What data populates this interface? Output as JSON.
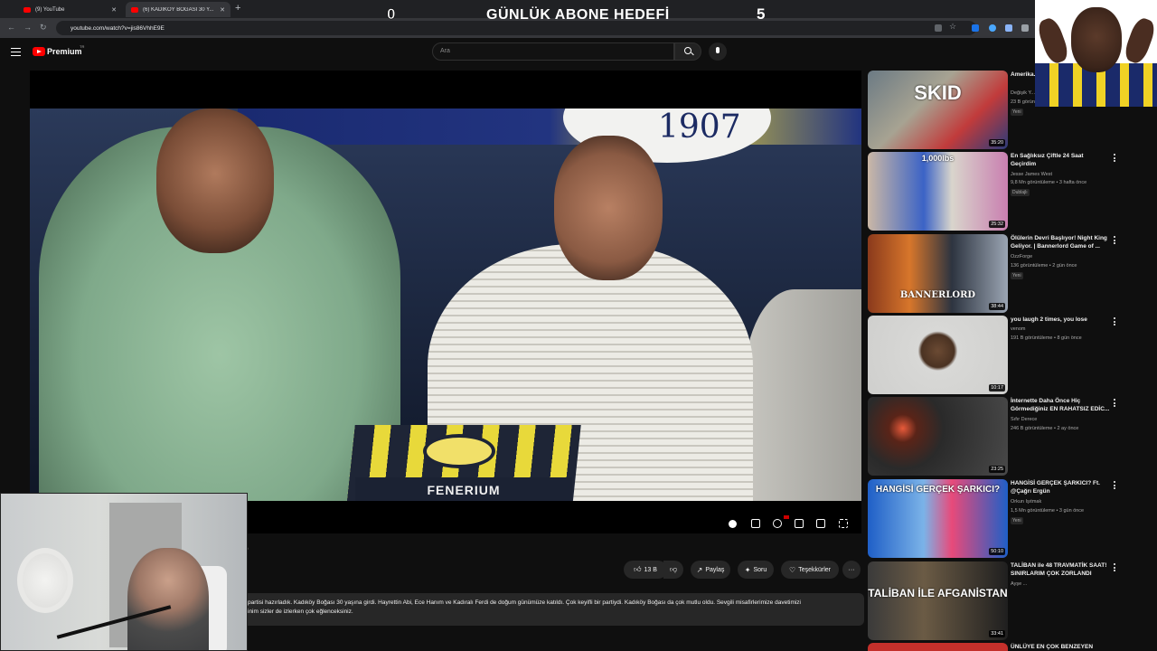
{
  "browser": {
    "tabs": [
      {
        "label": "(9) YouTube"
      },
      {
        "label": "(6) KADIKÖY BOĞASI 30 Y..."
      }
    ],
    "url": "youtube.com/watch?v=jis86VhhE9E"
  },
  "overlay": {
    "left_count": "0",
    "title": "GÜNLÜK ABONE HEDEFİ",
    "right_count": "5"
  },
  "youtube": {
    "brand": "Premium",
    "brand_sup": "TR",
    "search_placeholder": "Ara"
  },
  "player": {
    "scene_text_club": "1907",
    "scene_text_box": "FENERIUM"
  },
  "actions": {
    "likes": "13 B",
    "share": "Paylaş",
    "ask": "Soru",
    "thanks": "Teşekkürler"
  },
  "description": {
    "line1": "partisi hazırladık. Kadıköy Boğası 30 yaşına girdi. Hayrettin Abi, Ece Hanım ve Kadıralı Ferdi de doğum günümüze katıldı. Çok keyifli bir partiydi. Kadıköy Boğası da çok mutlu oldu. Sevgili misafirlerimize davetimizi",
    "line2": "inim sizler de izlerken çok eğlenceksiniz."
  },
  "recommendations": [
    {
      "title": "Amerika... Mahalle...",
      "channel": "Değişik Y...",
      "meta": "23 B görüntülenme",
      "badge": "Yeni",
      "duration": "35:20",
      "thumb_text": "SKID"
    },
    {
      "title": "En Sağlıksız Çiftle 24 Saat Geçirdim",
      "channel": "Jesse James West",
      "meta": "9,8 Mn görüntüleme • 3 hafta önce",
      "badge": "Dublajlı",
      "duration": "25:32",
      "thumb_text": "1,000lbs"
    },
    {
      "title": "Ölülerin Devri Başlıyor! Night King Geliyor. | Bannerlord Game of ...",
      "channel": "OzzForge",
      "meta": "136 görüntüleme • 2 gün önce",
      "badge": "Yeni",
      "duration": "38:44",
      "thumb_text": "BANNERLORD"
    },
    {
      "title": "you laugh 2 times, you lose",
      "channel": "venom",
      "meta": "191 B görüntüleme • 8 gün önce",
      "badge": "",
      "duration": "10:17",
      "thumb_text": ""
    },
    {
      "title": "İnternette Daha Önce Hiç Görmediğiniz EN RAHATSIZ EDİC...",
      "channel": "Sıfır Derece",
      "meta": "246 B görüntüleme • 2 ay önce",
      "badge": "",
      "duration": "23:25",
      "thumb_text": ""
    },
    {
      "title": "HANGİSİ GERÇEK ŞARKICI? Ft. @Çağrı Ergün",
      "channel": "Orkun Işıtmak",
      "meta": "1,5 Mn görüntüleme • 3 gün önce",
      "badge": "Yeni",
      "duration": "50:10",
      "thumb_text": "HANGİSİ GERÇEK ŞARKICI?"
    },
    {
      "title": "TALİBAN ile 48 TRAVMATİK SAAT! SINIRLARIM ÇOK ZORLANDI",
      "channel": "Ayşe ...",
      "meta": "",
      "badge": "",
      "duration": "33:41",
      "thumb_text": "TALİBAN İLE AFGANİSTAN"
    },
    {
      "title": "ÜNLÜYE EN ÇOK BENZEYEN",
      "channel": "",
      "meta": "",
      "badge": "",
      "duration": "",
      "thumb_text": ""
    }
  ],
  "colors": {
    "yt_red": "#ff0000",
    "background": "#0f0f0f"
  }
}
